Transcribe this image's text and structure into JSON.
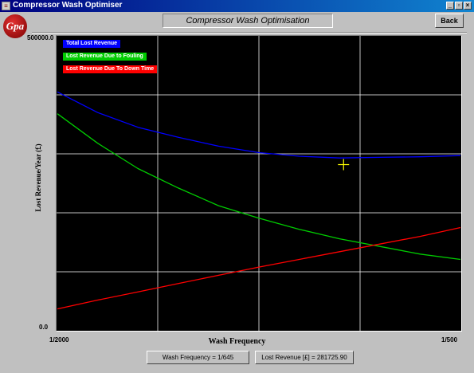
{
  "window": {
    "title": "Compressor Wash Optimiser",
    "app_icon": "window-icon",
    "controls": [
      "_",
      "▫",
      "×"
    ]
  },
  "logo": {
    "text": "Gpa"
  },
  "header": {
    "title": "Compressor Wash Optimisation"
  },
  "back_button": {
    "label": "Back"
  },
  "chart_data": {
    "type": "line",
    "ylabel": "Lost Revenue/Year (£)",
    "xlabel": "Wash Frequency",
    "y_tick_labels": [
      "500000.0",
      "0.0"
    ],
    "x_tick_labels": [
      "1/2000",
      "1/500"
    ],
    "ylim": [
      0,
      500000
    ],
    "grid": true,
    "legend_position": "top-left",
    "background": "#000000",
    "x": [
      0.0,
      0.1,
      0.2,
      0.3,
      0.4,
      0.5,
      0.6,
      0.7,
      0.8,
      0.9,
      1.0
    ],
    "series": [
      {
        "name": "Total Lost Revenue",
        "color": "#0000ff",
        "values": [
          405000,
          370000,
          345000,
          328000,
          313000,
          302000,
          296000,
          293000,
          294000,
          295000,
          297000
        ]
      },
      {
        "name": "Lost Revenue  Due to Fouling",
        "color": "#00cc00",
        "values": [
          368000,
          318000,
          275000,
          242000,
          212000,
          191000,
          172000,
          156000,
          143000,
          130000,
          121000
        ]
      },
      {
        "name": "Lost Revenue Due To Down Time",
        "color": "#ff0000",
        "values": [
          37000,
          52000,
          66000,
          80000,
          94000,
          108000,
          121000,
          134000,
          147000,
          160000,
          175000
        ]
      }
    ],
    "cursor": {
      "x": 0.71,
      "y": 281725.9,
      "color": "#ffff00"
    }
  },
  "status": {
    "wash_frequency": "Wash Frequency = 1/645",
    "lost_revenue": "Lost Revenue [£] = 281725.90"
  }
}
